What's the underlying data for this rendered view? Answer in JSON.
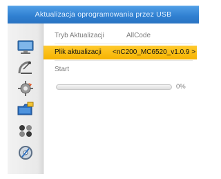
{
  "title": "Aktualizacja oprogramowania przez USB",
  "sidebar": {
    "icons": [
      "monitor-icon",
      "satellite-dish-icon",
      "gear-icon",
      "usb-folder-icon",
      "games-icon",
      "media-disc-icon"
    ]
  },
  "menu": {
    "mode": {
      "label": "Tryb Aktualizacji",
      "value": "AllCode"
    },
    "file": {
      "label": "Plik aktualizacji",
      "value": "<nC200_MC6520_v1.0.9 >"
    },
    "start": {
      "label": "Start"
    }
  },
  "progress": {
    "value": 0,
    "text": "0%"
  },
  "colors": {
    "title_bar": "#2f7fd0",
    "highlight": "#f6b300",
    "text_muted": "#7a7a7a"
  }
}
